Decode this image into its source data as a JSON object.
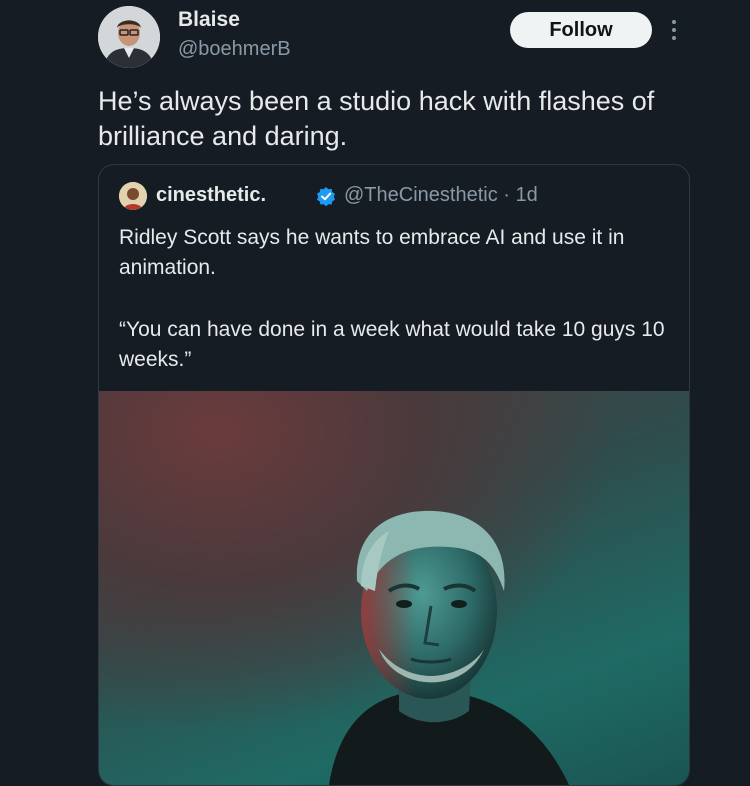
{
  "author": {
    "name": "Blaise",
    "handle": "@boehmerB",
    "avatar_icon": "profile-photo"
  },
  "follow_label": "Follow",
  "post_text": "He’s always been a studio hack with flashes of brilliance and daring.",
  "quoted_post": {
    "name": "cinesthetic.",
    "verified": true,
    "handle_time": "@TheCinesthetic · 1d",
    "text": "Ridley Scott says he wants to embrace AI and use it in animation.",
    "quote": "“You can have done in a week what would take 10 guys 10 weeks.”",
    "media_icon": "portrait-photo"
  },
  "colors": {
    "background": "#151c24",
    "text": "#e7e9ea",
    "muted": "#8b98a5",
    "verified": "#1d9bf0",
    "button_bg": "#eff3f4"
  }
}
